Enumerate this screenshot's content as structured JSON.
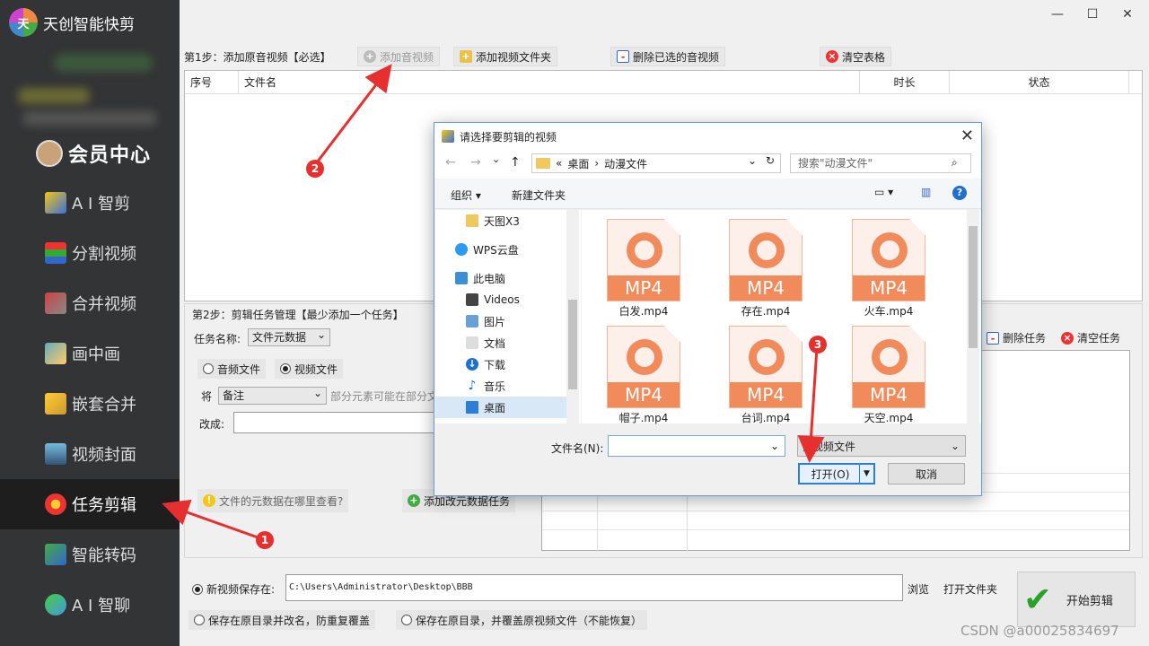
{
  "app": {
    "title": "天创智能快剪",
    "logo_text": "天"
  },
  "sidebar": {
    "member_label": "会员中心",
    "items": [
      {
        "label": "A I 智剪",
        "icon": "ai-cut-icon"
      },
      {
        "label": "分割视频",
        "icon": "split-video-icon"
      },
      {
        "label": "合并视频",
        "icon": "merge-video-icon"
      },
      {
        "label": "画中画",
        "icon": "pip-icon"
      },
      {
        "label": "嵌套合并",
        "icon": "nested-merge-icon"
      },
      {
        "label": "视频封面",
        "icon": "video-cover-icon"
      },
      {
        "label": "任务剪辑",
        "icon": "task-edit-icon",
        "active": true
      },
      {
        "label": "智能转码",
        "icon": "transcode-icon"
      },
      {
        "label": "A I 智聊",
        "icon": "ai-chat-icon"
      }
    ]
  },
  "window": {
    "minimize": "—",
    "maximize": "☐",
    "close": "✕"
  },
  "step1": {
    "label": "第1步：添加原音视频【必选】",
    "add_av": "添加音视频",
    "add_folder": "添加视频文件夹",
    "delete_selected": "删除已选的音视频",
    "clear_table": "清空表格",
    "columns": {
      "index": "序号",
      "filename": "文件名",
      "duration": "时长",
      "status": "状态"
    }
  },
  "step2": {
    "label": "第2步：剪辑任务管理【最少添加一个任务】",
    "task_name_label": "任务名称:",
    "task_name_value": "文件元数据",
    "radio_audio": "音频文件",
    "radio_video": "视频文件",
    "field_label": "将",
    "field_value": "备注",
    "field_hint": "部分元素可能在部分文",
    "change_label": "改成:",
    "help_text": "文件的元数据在哪里查看?",
    "add_task": "添加改元数据任务",
    "delete_task": "删除任务",
    "clear_task": "清空任务"
  },
  "bottom": {
    "save_label": "新视频保存在:",
    "save_path": "C:\\Users\\Administrator\\Desktop\\BBB",
    "browse": "浏览",
    "open_folder": "打开文件夹",
    "option_rename": "保存在原目录并改名，防重复覆盖",
    "option_overwrite": "保存在原目录，并覆盖原视频文件（不能恢复）",
    "start": "开始剪辑"
  },
  "dialog": {
    "title": "请选择要剪辑的视频",
    "breadcrumb": [
      "«",
      "桌面",
      "›",
      "动漫文件"
    ],
    "search_placeholder": "搜索\"动漫文件\"",
    "organize": "组织 ▾",
    "new_folder": "新建文件夹",
    "tree": [
      {
        "label": "天图X3",
        "icon": "folder-icon"
      },
      {
        "label": "WPS云盘",
        "icon": "cloud-icon"
      },
      {
        "label": "此电脑",
        "icon": "computer-icon"
      },
      {
        "label": "Videos",
        "icon": "videos-icon"
      },
      {
        "label": "图片",
        "icon": "pictures-icon"
      },
      {
        "label": "文档",
        "icon": "documents-icon"
      },
      {
        "label": "下载",
        "icon": "download-icon"
      },
      {
        "label": "音乐",
        "icon": "music-icon"
      },
      {
        "label": "桌面",
        "icon": "desktop-icon",
        "selected": true
      }
    ],
    "files": [
      {
        "name": "白发.mp4",
        "badge": "MP4"
      },
      {
        "name": "存在.mp4",
        "badge": "MP4"
      },
      {
        "name": "火车.mp4",
        "badge": "MP4"
      },
      {
        "name": "帽子.mp4",
        "badge": "MP4"
      },
      {
        "name": "台词.mp4",
        "badge": "MP4"
      },
      {
        "name": "天空.mp4",
        "badge": "MP4"
      }
    ],
    "filename_label": "文件名(N):",
    "filename_value": "",
    "filetype": "音视频文件",
    "open": "打开(O)",
    "cancel": "取消"
  },
  "annotations": [
    "1",
    "2",
    "3"
  ],
  "watermark": "CSDN @a00025834697",
  "colors": {
    "sidebar_bg": "#333435",
    "accent_red": "#e63030",
    "mp4_orange": "#f28b5c"
  }
}
